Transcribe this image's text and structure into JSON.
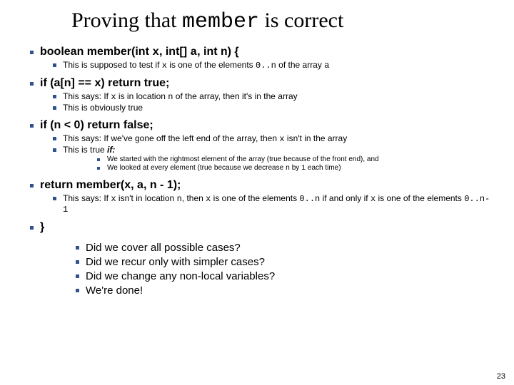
{
  "title": {
    "pre": "Proving that ",
    "mono": "member",
    "post": " is correct"
  },
  "l1_boolean": {
    "pre": "boolean member(int ",
    "x": "x",
    "mid1": ", int[] ",
    "a": "a",
    "mid2": ", int ",
    "n": "n",
    "close": ") {"
  },
  "l2_supposed": {
    "pre": "This is supposed to test if ",
    "x": "x",
    "mid": " is one of the elements ",
    "range": "0..n",
    "post": " of the array ",
    "a": "a"
  },
  "l1_if_true": "if (a[n] == x) return true;",
  "l2_says_loc": {
    "pre": "This says: If ",
    "x": "x",
    "mid1": " is in location ",
    "n": "n",
    "post": " of the array, then it's in the array"
  },
  "l2_obv": "This is obviously true",
  "l1_if_false": "if (n < 0) return false;",
  "l2_gone_off": {
    "pre": "This says: If we've gone off the left end of the array, then ",
    "x": "x",
    "post": " isn't in the array"
  },
  "l2_true_if": {
    "pre": "This is true ",
    "if": "if:"
  },
  "l3_started": "We started with the rightmost element of the array (true because of the front end), and",
  "l3_looked": {
    "pre": "We looked at every element (true because we decrease ",
    "n": "n",
    "mid": " by ",
    "one": "1",
    "post": " each time)"
  },
  "l1_return": "return member(x, a, n - 1);",
  "l2_says_if": {
    "pre": "This says: If ",
    "x1": "x",
    "mid1": " isn't in location ",
    "n": "n",
    "mid2": ", then ",
    "x2": "x",
    "mid3": " is one of the elements ",
    "r1": "0..n",
    "mid4": " if and only if ",
    "x3": "x",
    "mid5": " is one of the elements ",
    "r2": "0..n-1"
  },
  "l1_close": "}",
  "q1": "Did we cover all possible cases?",
  "q2": "Did we recur only with simpler cases?",
  "q3": "Did we change any non-local variables?",
  "q4": "We're done!",
  "pagenum": "23"
}
